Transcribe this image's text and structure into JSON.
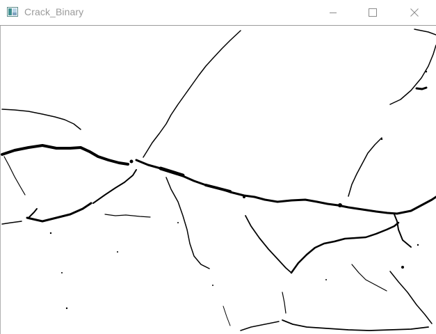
{
  "window": {
    "title": "Crack_Binary",
    "icons": {
      "app": "opencv-window-icon",
      "minimize": "minimize-icon",
      "maximize": "maximize-icon",
      "close": "close-icon"
    }
  },
  "image": {
    "description_type": "binary-crack-mask",
    "foreground_color": "#000000",
    "background_color": "#ffffff"
  }
}
